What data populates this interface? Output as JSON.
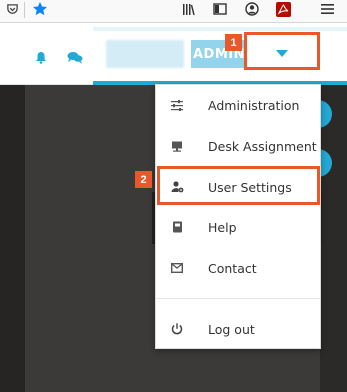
{
  "browser": {
    "icons": [
      "pocket-icon",
      "bookmark-star-icon",
      "library-icon",
      "sidebar-icon",
      "account-icon",
      "pdf-icon",
      "hamburger-menu-icon"
    ]
  },
  "header": {
    "username_label": "",
    "role_label": "ADMIN",
    "accent_color": "#22a9d6",
    "annotation_color": "#e8582a"
  },
  "annotations": {
    "marker_1": "1",
    "marker_2": "2"
  },
  "menu": {
    "items": [
      {
        "label": "Administration",
        "icon": "sliders-icon"
      },
      {
        "label": "Desk Assignment",
        "icon": "monitor-icon"
      },
      {
        "label": "User Settings",
        "icon": "user-gear-icon"
      },
      {
        "label": "Help",
        "icon": "book-icon"
      },
      {
        "label": "Contact",
        "icon": "envelope-icon"
      },
      {
        "label": "Log out",
        "icon": "power-icon"
      }
    ]
  }
}
